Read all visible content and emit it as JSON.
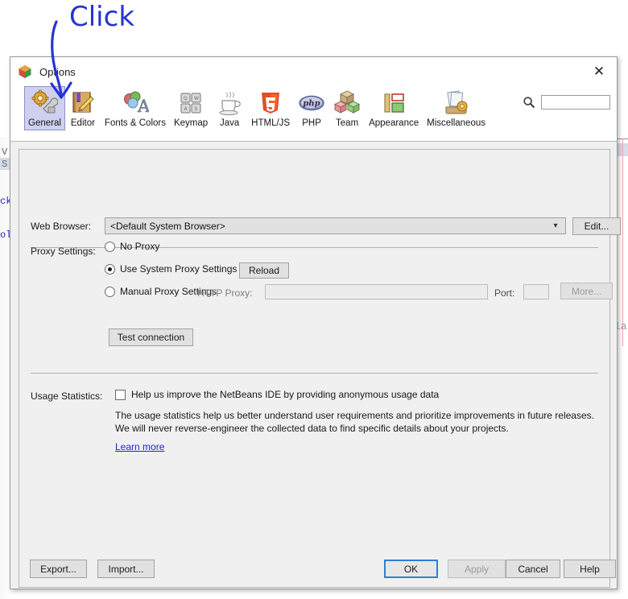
{
  "dialog": {
    "title": "Options",
    "logo_icon": "netbeans-cube-icon",
    "close_icon": "close-icon"
  },
  "search": {
    "icon": "search-icon",
    "value": "",
    "placeholder": ""
  },
  "categories": [
    {
      "label": "General",
      "icon": "gear-wrench-icon",
      "selected": true
    },
    {
      "label": "Editor",
      "icon": "book-pencil-icon",
      "selected": false
    },
    {
      "label": "Fonts & Colors",
      "icon": "palette-letter-icon",
      "selected": false
    },
    {
      "label": "Keymap",
      "icon": "keyboard-keys-icon",
      "selected": false
    },
    {
      "label": "Java",
      "icon": "coffee-cup-icon",
      "selected": false
    },
    {
      "label": "HTML/JS",
      "icon": "html5-shield-icon",
      "selected": false
    },
    {
      "label": "PHP",
      "icon": "php-elephant-icon",
      "selected": false
    },
    {
      "label": "Team",
      "icon": "cubes-icon",
      "selected": false
    },
    {
      "label": "Appearance",
      "icon": "layout-blocks-icon",
      "selected": false
    },
    {
      "label": "Miscellaneous",
      "icon": "papers-gear-icon",
      "selected": false
    }
  ],
  "general": {
    "web_browser_label": "Web Browser:",
    "web_browser_value": "<Default System Browser>",
    "web_browser_arrow_icon": "chevron-down-icon",
    "edit_button": "Edit...",
    "proxy_label": "Proxy Settings:",
    "proxy_options": [
      {
        "label": "No Proxy",
        "checked": false
      },
      {
        "label": "Use System Proxy Settings",
        "checked": true
      },
      {
        "label": "Manual Proxy Settings",
        "checked": false
      }
    ],
    "reload_button": "Reload",
    "http_proxy_label": "HTTP Proxy:",
    "http_proxy_value": "",
    "port_label": "Port:",
    "port_value": "",
    "more_button": "More...",
    "test_connection_button": "Test connection",
    "usage_label": "Usage Statistics:",
    "usage_checkbox_label": "Help us improve the NetBeans IDE by providing anonymous usage data",
    "usage_checkbox_checked": false,
    "usage_description": "The usage statistics help us better understand user requirements and prioritize improvements in future releases. We will never reverse-engineer the collected data to find specific details about your projects.",
    "learn_more": "Learn more"
  },
  "buttons": {
    "export": "Export...",
    "import": "Import...",
    "ok": "OK",
    "apply": "Apply",
    "apply_disabled": true,
    "cancel": "Cancel",
    "help": "Help"
  },
  "annotation": {
    "text": "Click",
    "color": "#2633d6",
    "arrow_icon": "handdrawn-arrow-icon",
    "points_to": "Editor"
  },
  "background": {
    "left_fragments": [
      "V",
      "S",
      "ck",
      "ol"
    ],
    "right_fragment": "la"
  },
  "colors": {
    "dialog_bg": "#f0f0f0",
    "titlebar_bg": "#ffffff",
    "selected_category_bg": "#cfd0ef",
    "selected_category_border": "#8f90c8",
    "default_focus_border": "#2f7fd1",
    "link": "#2222cc",
    "annotation": "#2633d6"
  }
}
